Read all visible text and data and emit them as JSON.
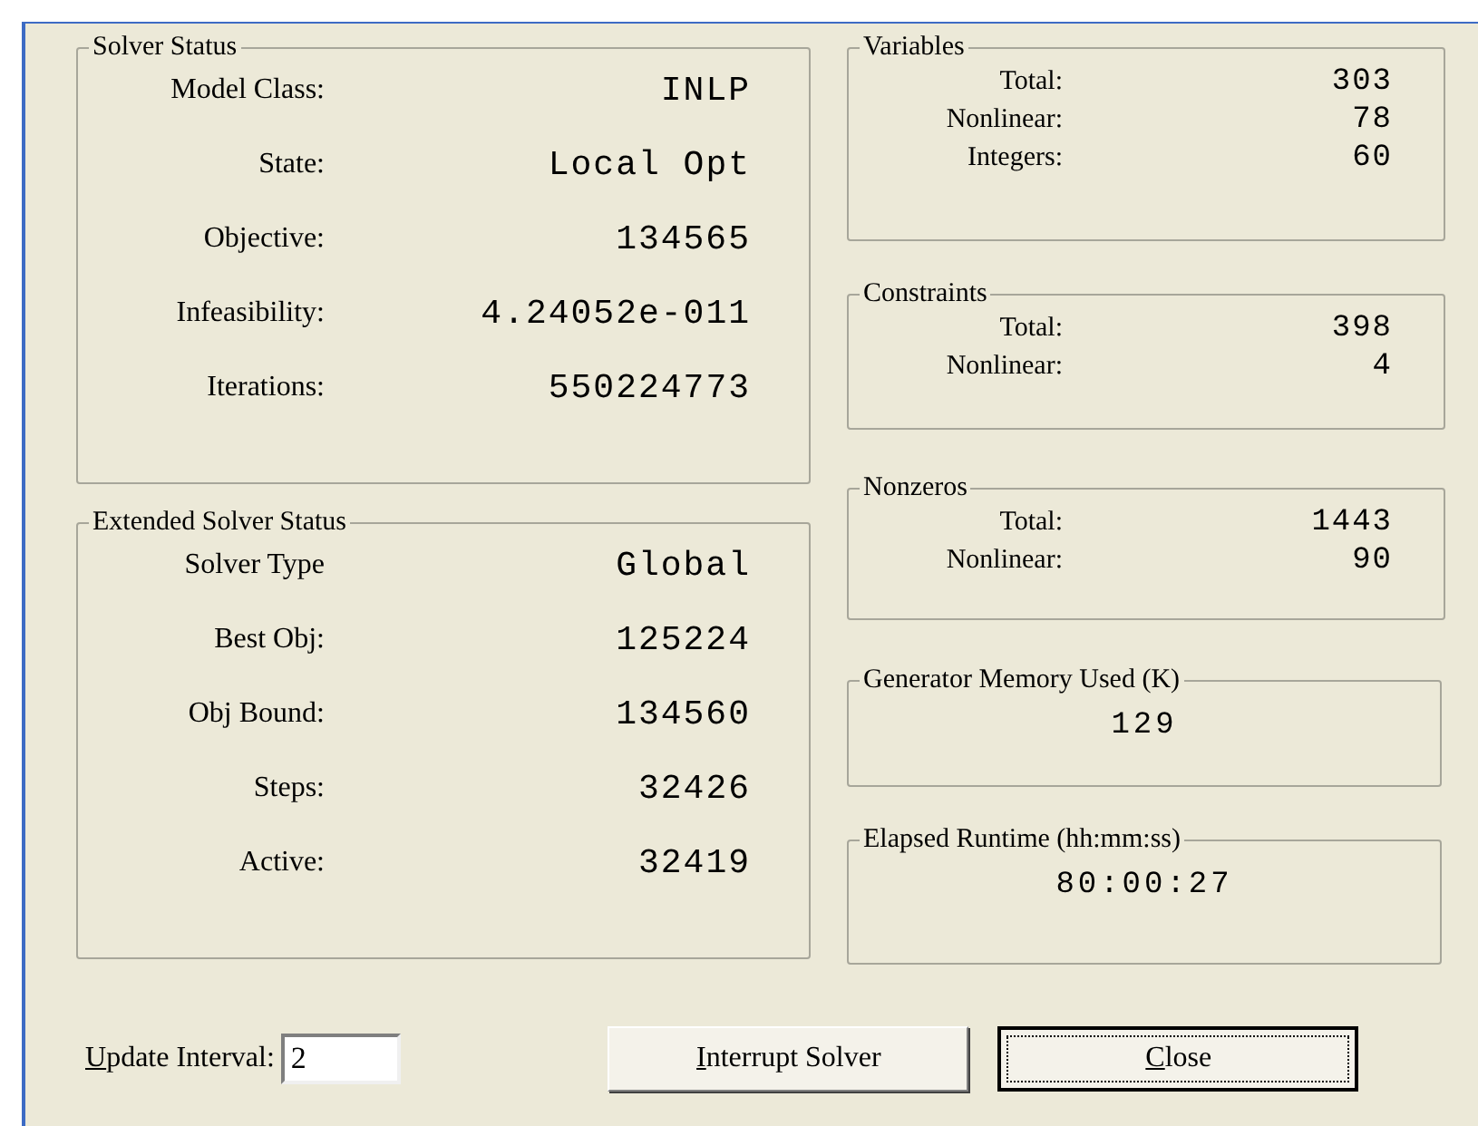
{
  "solver_status": {
    "title": "Solver Status",
    "rows": [
      {
        "label": "Model Class:",
        "value": "INLP"
      },
      {
        "label": "State:",
        "value": "Local Opt"
      },
      {
        "label": "Objective:",
        "value": "134565"
      },
      {
        "label": "Infeasibility:",
        "value": "4.24052e-011"
      },
      {
        "label": "Iterations:",
        "value": "550224773"
      }
    ]
  },
  "extended_solver_status": {
    "title": "Extended Solver Status",
    "rows": [
      {
        "label": "Solver Type",
        "value": "Global"
      },
      {
        "label": "Best Obj:",
        "value": "125224"
      },
      {
        "label": "Obj Bound:",
        "value": "134560"
      },
      {
        "label": "Steps:",
        "value": "32426"
      },
      {
        "label": "Active:",
        "value": "32419"
      }
    ]
  },
  "variables": {
    "title": "Variables",
    "rows": [
      {
        "label": "Total:",
        "value": "303"
      },
      {
        "label": "Nonlinear:",
        "value": "78"
      },
      {
        "label": "Integers:",
        "value": "60"
      }
    ]
  },
  "constraints": {
    "title": "Constraints",
    "rows": [
      {
        "label": "Total:",
        "value": "398"
      },
      {
        "label": "Nonlinear:",
        "value": "4"
      }
    ]
  },
  "nonzeros": {
    "title": "Nonzeros",
    "rows": [
      {
        "label": "Total:",
        "value": "1443"
      },
      {
        "label": "Nonlinear:",
        "value": "90"
      }
    ]
  },
  "generator_memory": {
    "title": "Generator Memory Used (K)",
    "value": "129"
  },
  "elapsed_runtime": {
    "title": "Elapsed Runtime (hh:mm:ss)",
    "value": "80:00:27"
  },
  "update_interval": {
    "label": "Update Interval:",
    "first_letter_underlined": true,
    "value": "2"
  },
  "buttons": [
    {
      "label": "Interrupt Solver",
      "first_letter_underlined": true,
      "focused": false
    },
    {
      "label": "Close",
      "first_letter_underlined": true,
      "focused": true
    }
  ]
}
